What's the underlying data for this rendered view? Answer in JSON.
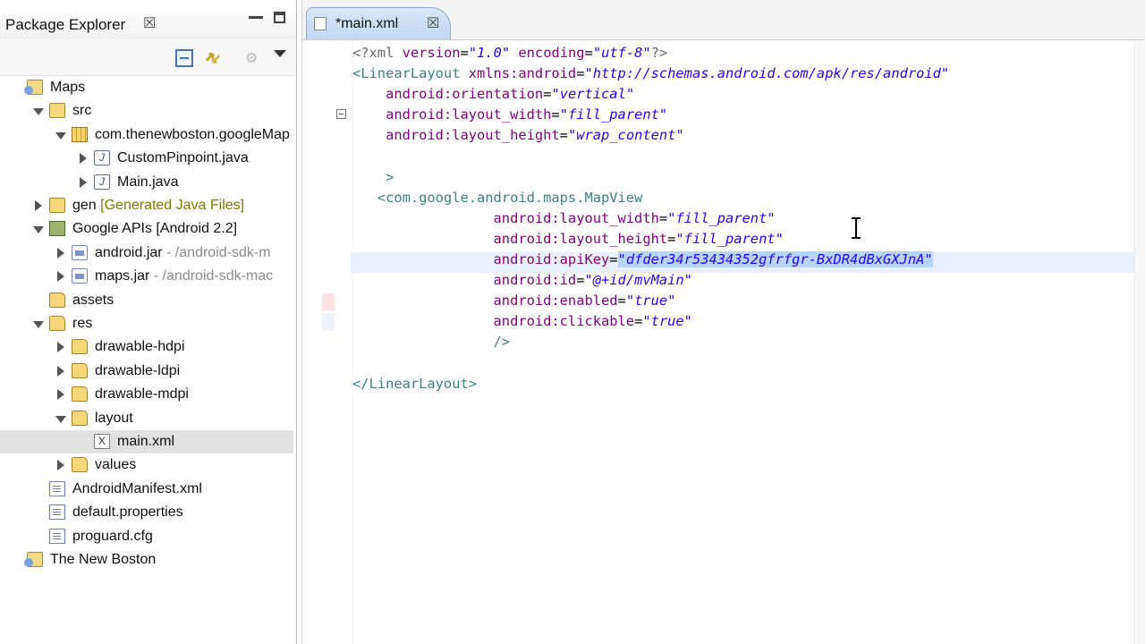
{
  "explorer": {
    "title": "Package Explorer",
    "tree": [
      {
        "id": "maps",
        "label": "Maps",
        "icon": "project-icon",
        "twisty": "none"
      },
      {
        "id": "src",
        "label": "src",
        "icon": "source-folder-icon",
        "twisty": "open"
      },
      {
        "id": "pkg",
        "label": "com.thenewboston.googleMap",
        "icon": "package-icon",
        "twisty": "open"
      },
      {
        "id": "custompinpoint",
        "label": "CustomPinpoint.java",
        "icon": "java-file-icon",
        "twisty": "closed"
      },
      {
        "id": "mainjava",
        "label": "Main.java",
        "icon": "java-file-icon",
        "twisty": "closed"
      },
      {
        "id": "gen",
        "label": "gen",
        "extra": "[Generated Java Files]",
        "icon": "source-folder-icon",
        "twisty": "closed"
      },
      {
        "id": "googleapis",
        "label": "Google APIs [Android 2.2]",
        "icon": "library-icon",
        "twisty": "open"
      },
      {
        "id": "androidjar",
        "label": "android.jar",
        "extra": "- /android-sdk-m",
        "icon": "jar-icon",
        "twisty": "closed"
      },
      {
        "id": "mapsjar",
        "label": "maps.jar",
        "extra": "- /android-sdk-mac",
        "icon": "jar-icon",
        "twisty": "closed"
      },
      {
        "id": "assets",
        "label": "assets",
        "icon": "folder-icon",
        "twisty": "none"
      },
      {
        "id": "res",
        "label": "res",
        "icon": "folder-icon",
        "twisty": "open"
      },
      {
        "id": "hdpi",
        "label": "drawable-hdpi",
        "icon": "folder-icon",
        "twisty": "closed"
      },
      {
        "id": "ldpi",
        "label": "drawable-ldpi",
        "icon": "folder-icon",
        "twisty": "closed"
      },
      {
        "id": "mdpi",
        "label": "drawable-mdpi",
        "icon": "folder-icon",
        "twisty": "closed"
      },
      {
        "id": "layout",
        "label": "layout",
        "icon": "folder-icon",
        "twisty": "open"
      },
      {
        "id": "mainxml",
        "label": "main.xml",
        "icon": "xml-file-icon",
        "twisty": "none",
        "selected": true
      },
      {
        "id": "values",
        "label": "values",
        "icon": "folder-icon",
        "twisty": "closed"
      },
      {
        "id": "manifest",
        "label": "AndroidManifest.xml",
        "icon": "manifest-icon",
        "twisty": "none"
      },
      {
        "id": "defaultprops",
        "label": "default.properties",
        "icon": "file-icon",
        "twisty": "none"
      },
      {
        "id": "proguard",
        "label": "proguard.cfg",
        "icon": "file-icon",
        "twisty": "none"
      },
      {
        "id": "newboston",
        "label": "The New Boston",
        "icon": "project-icon",
        "twisty": "none"
      }
    ]
  },
  "editor": {
    "tab_label": "*main.xml",
    "lines": [
      [
        {
          "t": "pi",
          "s": "<?xml "
        },
        {
          "t": "attr",
          "s": "version"
        },
        {
          "t": "eq",
          "s": "="
        },
        {
          "t": "val",
          "s": "\"1.0\""
        },
        {
          "t": "pi",
          "s": " "
        },
        {
          "t": "attr",
          "s": "encoding"
        },
        {
          "t": "eq",
          "s": "="
        },
        {
          "t": "val",
          "s": "\"utf-8\""
        },
        {
          "t": "pi",
          "s": "?>"
        }
      ],
      [
        {
          "t": "tag",
          "s": "<LinearLayout "
        },
        {
          "t": "attr",
          "s": "xmlns:android"
        },
        {
          "t": "eq",
          "s": "="
        },
        {
          "t": "val",
          "s": "\"http://schemas.android.com/apk/res/android\""
        }
      ],
      [
        {
          "t": "pi",
          "s": "    "
        },
        {
          "t": "attr",
          "s": "android:orientation"
        },
        {
          "t": "eq",
          "s": "="
        },
        {
          "t": "val",
          "s": "\"vertical\""
        }
      ],
      [
        {
          "t": "pi",
          "s": "    "
        },
        {
          "t": "attr",
          "s": "android:layout_width"
        },
        {
          "t": "eq",
          "s": "="
        },
        {
          "t": "val",
          "s": "\"fill_parent\""
        }
      ],
      [
        {
          "t": "pi",
          "s": "    "
        },
        {
          "t": "attr",
          "s": "android:layout_height"
        },
        {
          "t": "eq",
          "s": "="
        },
        {
          "t": "val",
          "s": "\"wrap_content\""
        }
      ],
      [],
      [
        {
          "t": "pi",
          "s": "    "
        },
        {
          "t": "tag",
          "s": ">"
        }
      ],
      [
        {
          "t": "pi",
          "s": "   "
        },
        {
          "t": "tag",
          "s": "<com.google.android.maps.MapView"
        }
      ],
      [
        {
          "t": "pi",
          "s": "                 "
        },
        {
          "t": "attr",
          "s": "android:layout_width"
        },
        {
          "t": "eq",
          "s": "="
        },
        {
          "t": "val",
          "s": "\"fill_parent\""
        }
      ],
      [
        {
          "t": "pi",
          "s": "                 "
        },
        {
          "t": "attr",
          "s": "android:layout_height"
        },
        {
          "t": "eq",
          "s": "="
        },
        {
          "t": "val",
          "s": "\"fill_parent\""
        }
      ],
      [
        {
          "t": "pi",
          "s": "                 "
        },
        {
          "t": "attr",
          "s": "android:apiKey"
        },
        {
          "t": "eq",
          "s": "="
        },
        {
          "t": "sel",
          "s": "\"dfder34r53434352gfrfgr-BxDR4dBxGXJnA\""
        }
      ],
      [
        {
          "t": "pi",
          "s": "                 "
        },
        {
          "t": "attr",
          "s": "android:id"
        },
        {
          "t": "eq",
          "s": "="
        },
        {
          "t": "val",
          "s": "\"@+id/mvMain\""
        }
      ],
      [
        {
          "t": "pi",
          "s": "                 "
        },
        {
          "t": "attr",
          "s": "android:enabled"
        },
        {
          "t": "eq",
          "s": "="
        },
        {
          "t": "val",
          "s": "\"true\""
        }
      ],
      [
        {
          "t": "pi",
          "s": "                 "
        },
        {
          "t": "attr",
          "s": "android:clickable"
        },
        {
          "t": "eq",
          "s": "="
        },
        {
          "t": "val",
          "s": "\"true\""
        }
      ],
      [
        {
          "t": "pi",
          "s": "                 "
        },
        {
          "t": "tag",
          "s": "/>"
        }
      ],
      [],
      [
        {
          "t": "tag",
          "s": "</LinearLayout>"
        }
      ]
    ]
  }
}
